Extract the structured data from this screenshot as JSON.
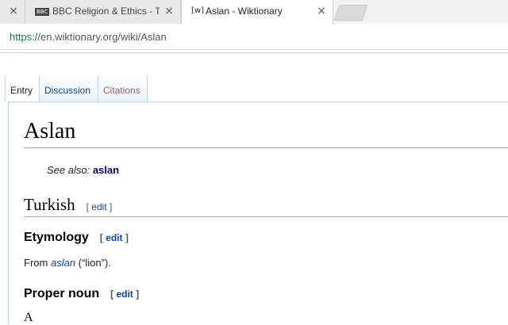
{
  "browser": {
    "tabs": [
      {
        "favicon": "",
        "title": "",
        "close": "×"
      },
      {
        "favicon": "BBC",
        "title": "BBC Religion & Ethics - T",
        "close": "×"
      },
      {
        "favicon": "[w]",
        "title": "Aslan - Wiktionary",
        "close": "×"
      }
    ],
    "url": {
      "scheme": "https://",
      "host_path": "en.wiktionary.org/wiki/Aslan"
    }
  },
  "page_tabs": {
    "entry": "Entry",
    "discussion": "Discussion",
    "citations": "Citations"
  },
  "article": {
    "title": "Aslan",
    "see_also_label": "See also:",
    "see_also_link": "aslan",
    "language_heading": "Turkish",
    "edit_label": "edit",
    "bracket_open": "[",
    "bracket_close": "]",
    "etymology_heading": "Etymology",
    "etymology_from": "From",
    "etymology_word": "aslan",
    "etymology_gloss": "(“lion”).",
    "proper_noun_heading": "Proper noun",
    "next_line_fragment": "A"
  },
  "colors": {
    "link": "#0645ad",
    "new_link": "#a55858",
    "visited_bold_link": "#0b0080",
    "tab_border": "#a7d7f9"
  }
}
